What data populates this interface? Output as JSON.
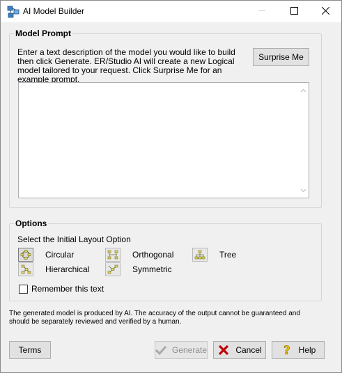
{
  "window": {
    "title": "AI Model Builder",
    "icon": "er-studio-app-icon"
  },
  "title_buttons": {
    "minimize_icon": "minimize-icon",
    "maximize_icon": "maximize-icon",
    "close_icon": "close-icon"
  },
  "model_prompt": {
    "legend": "Model Prompt",
    "description": "Enter a text description of the model you would like to build then click Generate. ER/Studio AI will create a new Logical model tailored to your request. Click Surprise Me for an example prompt.",
    "surprise_button": "Surprise Me",
    "prompt_value": ""
  },
  "options": {
    "legend": "Options",
    "select_label": "Select the Initial Layout Option",
    "layouts": {
      "circular": "Circular",
      "orthogonal": "Orthogonal",
      "tree": "Tree",
      "hierarchical": "Hierarchical",
      "symmetric": "Symmetric"
    },
    "selected_layout": "circular",
    "remember_label": "Remember this text",
    "remember_checked": false
  },
  "disclaimer": "The generated model is produced by AI. The accuracy of the output cannot be guaranteed and should be separately reviewed and verified by a human.",
  "buttons": {
    "terms": "Terms",
    "generate": "Generate",
    "cancel": "Cancel",
    "help": "Help"
  },
  "colors": {
    "cancel_x": "#c00000",
    "help_icon": "#f2c200",
    "generate_disabled": "#8d8d8d"
  }
}
